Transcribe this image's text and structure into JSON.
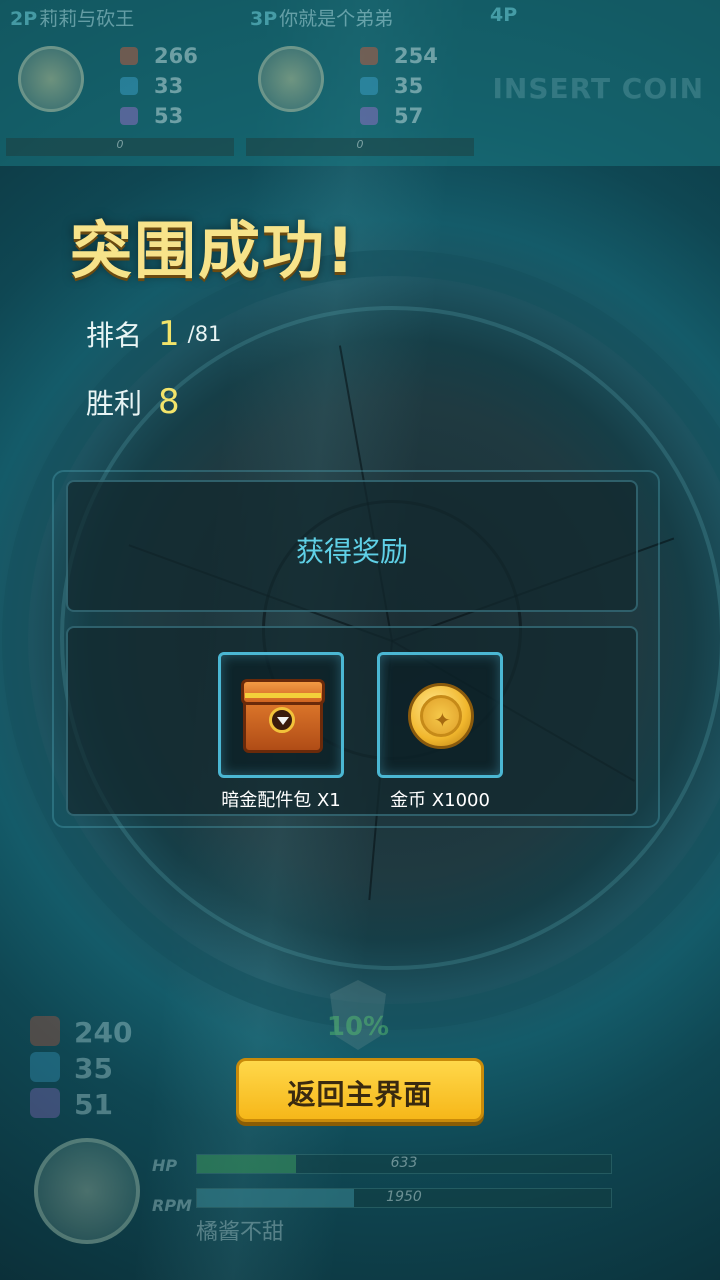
{
  "hud_top": {
    "players": [
      {
        "num": "2P",
        "name": "莉莉与砍王",
        "stats": [
          "266",
          "33",
          "53"
        ],
        "bar_value": "0"
      },
      {
        "num": "3P",
        "name": "你就是个弟弟",
        "stats": [
          "254",
          "35",
          "57"
        ],
        "bar_value": "0"
      },
      {
        "num": "4P",
        "name": "",
        "insert_coin": "INSERT COIN"
      }
    ]
  },
  "result": {
    "title": "突围成功!",
    "rank_label": "排名",
    "rank_value": "1",
    "rank_total": "/81",
    "wins_label": "胜利",
    "wins_value": "8"
  },
  "rewards": {
    "title": "获得奖励",
    "items": [
      {
        "label": "暗金配件包 X1",
        "icon": "treasure-chest-icon"
      },
      {
        "label": "金币 X1000",
        "icon": "gold-coin-icon"
      }
    ]
  },
  "hud_bottom": {
    "stats": [
      "240",
      "35",
      "51"
    ],
    "center_percent": "10%",
    "hp_label": "HP",
    "hp_value": "633",
    "hp_fraction": 0.24,
    "rpm_label": "RPM",
    "rpm_value": "1950",
    "rpm_fraction": 0.38,
    "player_name": "橘酱不甜"
  },
  "button": {
    "return_label": "返回主界面"
  },
  "colors": {
    "title": "#f7e38a",
    "accent_cyan": "#5fd0e6",
    "button_yellow": "#f6b719",
    "highlight_yellow": "#f2e46a"
  }
}
